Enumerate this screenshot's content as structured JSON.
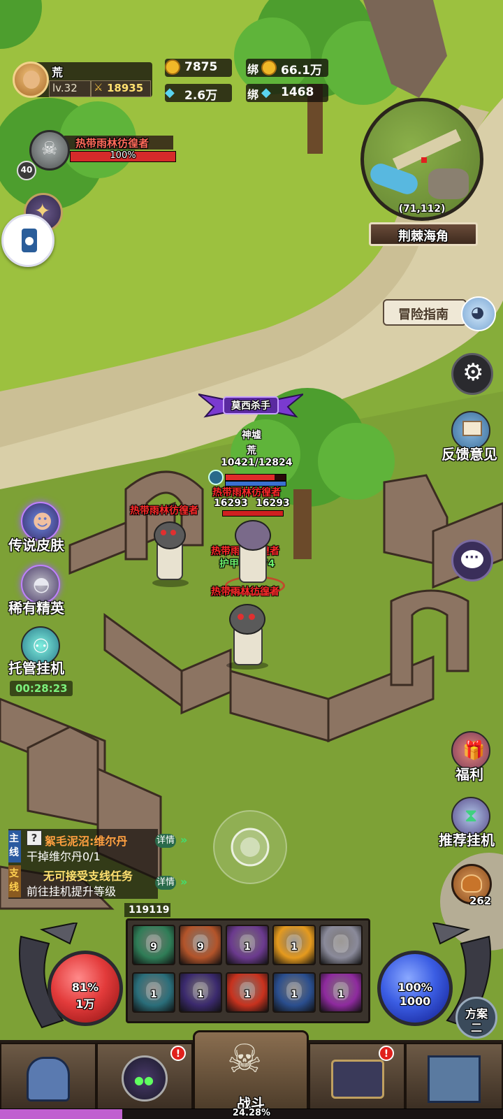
{
  "player": {
    "name": "荒",
    "level": "lv.32",
    "power": "18935"
  },
  "currency": {
    "gold": "7875",
    "diamond": "2.6万",
    "bound_label_1": "绑",
    "bound_gold": "66.1万",
    "bound_label_2": "绑",
    "bound_diamond": "1468"
  },
  "target": {
    "name": "热带雨林彷徨者",
    "percent": "100%",
    "level": "40"
  },
  "minimap": {
    "coords": "(71,112)",
    "location": "荆棘海角"
  },
  "right_menu": {
    "adventure_guide": "冒险指南",
    "feedback": "反馈意见",
    "welfare": "福利",
    "recommend_idle": "推荐挂机",
    "bread_count": "262"
  },
  "left_menu": {
    "legend_skin": "传说皮肤",
    "rare_elite": "稀有精英",
    "auto_idle": "托管挂机",
    "timer": "00:28:23"
  },
  "hero": {
    "title": "莫西杀手",
    "guild": "神墟",
    "name": "荒",
    "hp": "10421/12824",
    "hp_fraction": 0.81
  },
  "enemies": [
    {
      "name": "热带雨林彷徨者",
      "hp": "16293"
    },
    {
      "name": "热带雨林彷徨者",
      "hp": "16293"
    },
    {
      "name": "热带雨林彷徨者"
    },
    {
      "name": "热带雨林彷徨者"
    },
    {
      "name": "热带雨林彷徨者"
    }
  ],
  "combat_text": {
    "armor": "护甲: +274"
  },
  "quests": {
    "main_tag": "主线",
    "main_title": "絮毛泥沼:维尔丹",
    "main_desc": "干掉维尔丹0/1",
    "branch_tag": "支线",
    "branch_title": "无可接受支线任务",
    "branch_desc": "前往挂机提升等级",
    "details": "详情"
  },
  "combat_power_readout": "119119",
  "hp_orb": {
    "percent": "81%",
    "value": "1万"
  },
  "mp_orb": {
    "percent": "100%",
    "value": "1000"
  },
  "plan_button": {
    "line1": "方案",
    "line2": "二"
  },
  "skills": [
    {
      "count": "9",
      "color": "#2f7d57"
    },
    {
      "count": "9",
      "color": "#b3542a"
    },
    {
      "count": "1",
      "color": "#6b3a8e"
    },
    {
      "count": "1",
      "color": "#e59a1e"
    },
    {
      "count": "",
      "color": "#8a8a9a"
    },
    {
      "count": "1",
      "color": "#2a6e7a"
    },
    {
      "count": "1",
      "color": "#3b2a6e"
    },
    {
      "count": "1",
      "color": "#c8321e"
    },
    {
      "count": "1",
      "color": "#2a4e8e"
    },
    {
      "count": "1",
      "color": "#8e2a9e"
    }
  ],
  "bottom_nav": {
    "battle": "战斗",
    "exp_percent": "24.28%",
    "exp_fraction": 0.2428,
    "badge_1": "!",
    "badge_2": "!"
  },
  "colors": {
    "enemy_label": "#ff2a2a",
    "armor_text": "#6cf06c",
    "hp_orb": "#e33b3b",
    "mp_orb": "#3b5de3",
    "exp_bar": "#c060d0"
  }
}
